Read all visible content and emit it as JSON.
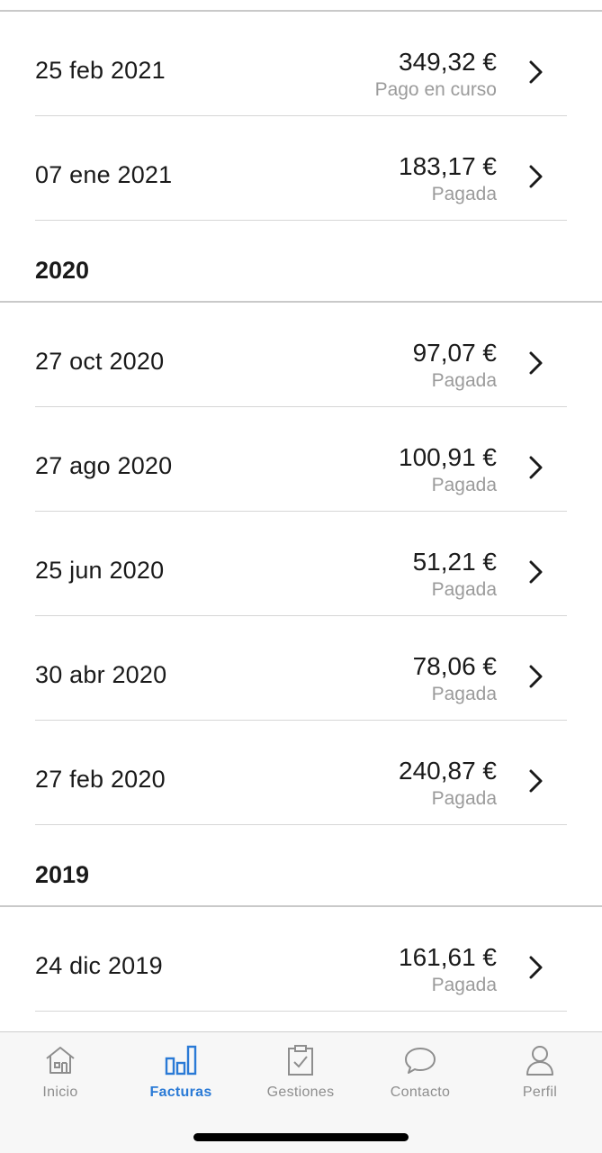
{
  "invoices": [
    {
      "type": "row",
      "date": "25 feb 2021",
      "amount": "349,32 €",
      "status": "Pago en curso"
    },
    {
      "type": "row",
      "date": "07 ene 2021",
      "amount": "183,17 €",
      "status": "Pagada"
    },
    {
      "type": "year",
      "label": "2020"
    },
    {
      "type": "row",
      "date": "27 oct 2020",
      "amount": "97,07 €",
      "status": "Pagada"
    },
    {
      "type": "row",
      "date": "27 ago 2020",
      "amount": "100,91 €",
      "status": "Pagada"
    },
    {
      "type": "row",
      "date": "25 jun 2020",
      "amount": "51,21 €",
      "status": "Pagada"
    },
    {
      "type": "row",
      "date": "30 abr 2020",
      "amount": "78,06 €",
      "status": "Pagada"
    },
    {
      "type": "row",
      "date": "27 feb 2020",
      "amount": "240,87 €",
      "status": "Pagada"
    },
    {
      "type": "year",
      "label": "2019"
    },
    {
      "type": "row",
      "date": "24 dic 2019",
      "amount": "161,61 €",
      "status": "Pagada"
    }
  ],
  "tabbar": {
    "tabs": [
      {
        "label": "Inicio",
        "icon": "house-icon",
        "active": false
      },
      {
        "label": "Facturas",
        "icon": "bar-chart-icon",
        "active": true
      },
      {
        "label": "Gestiones",
        "icon": "clipboard-check-icon",
        "active": false
      },
      {
        "label": "Contacto",
        "icon": "chat-bubble-icon",
        "active": false
      },
      {
        "label": "Perfil",
        "icon": "person-icon",
        "active": false
      }
    ]
  },
  "colors": {
    "accent": "#2a7ad6",
    "inactive": "#8e8e8e",
    "status_text": "#9b9b9b",
    "divider": "#d6d6d6"
  }
}
